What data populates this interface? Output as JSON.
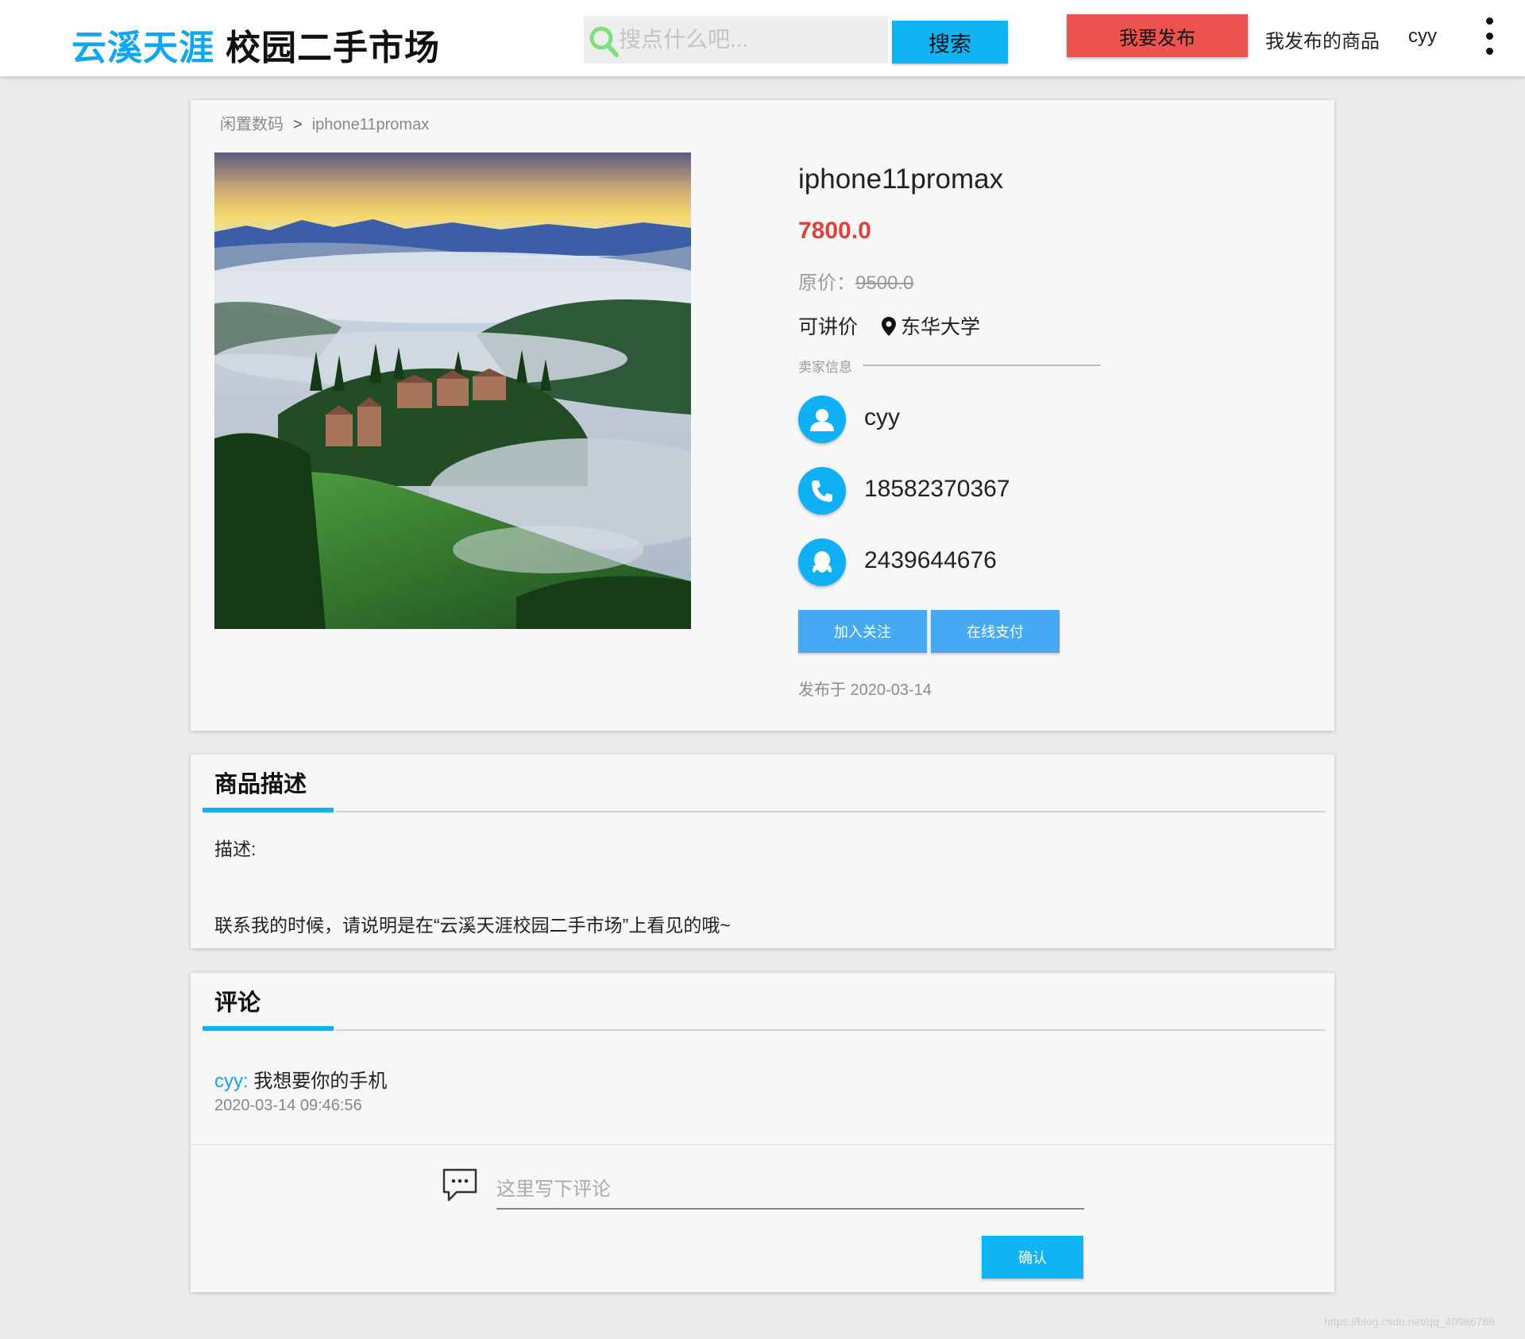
{
  "header": {
    "logo_brand": "云溪天涯",
    "logo_rest": "校园二手市场",
    "search_placeholder": "搜点什么吧...",
    "search_button": "搜索",
    "publish_button": "我要发布",
    "my_goods_link": "我发布的商品",
    "user_link": "cyy",
    "icons": {
      "search": "search-icon",
      "more": "more-vertical-icon"
    }
  },
  "breadcrumb": {
    "category": "闲置数码",
    "separator": ">",
    "current": "iphone11promax"
  },
  "product": {
    "title": "iphone11promax",
    "price": "7800.0",
    "original_price_label": "原价：",
    "original_price": "9500.0",
    "negotiable": "可讲价",
    "location": "东华大学",
    "image": "misty-hillside-village-landscape"
  },
  "seller": {
    "header": "卖家信息",
    "name": "cyy",
    "phone": "18582370367",
    "qq": "2439644676"
  },
  "actions": {
    "follow": "加入关注",
    "pay": "在线支付"
  },
  "publish_date": "发布于 2020-03-14",
  "description": {
    "title": "商品描述",
    "label": "描述:",
    "note": "联系我的时候，请说明是在“云溪天涯校园二手市场”上看见的哦~"
  },
  "comments": {
    "title": "评论",
    "items": [
      {
        "author": "cyy:",
        "text": " 我想要你的手机",
        "time": "2020-03-14 09:46:56"
      }
    ],
    "input_placeholder": "这里写下评论",
    "confirm_button": "确认"
  },
  "watermark": "https://blog.csdn.net/qq_40986788",
  "colors": {
    "accent": "#10b0f5",
    "publish": "#ee5350",
    "price": "#e0403c",
    "action": "#45a9f4"
  }
}
